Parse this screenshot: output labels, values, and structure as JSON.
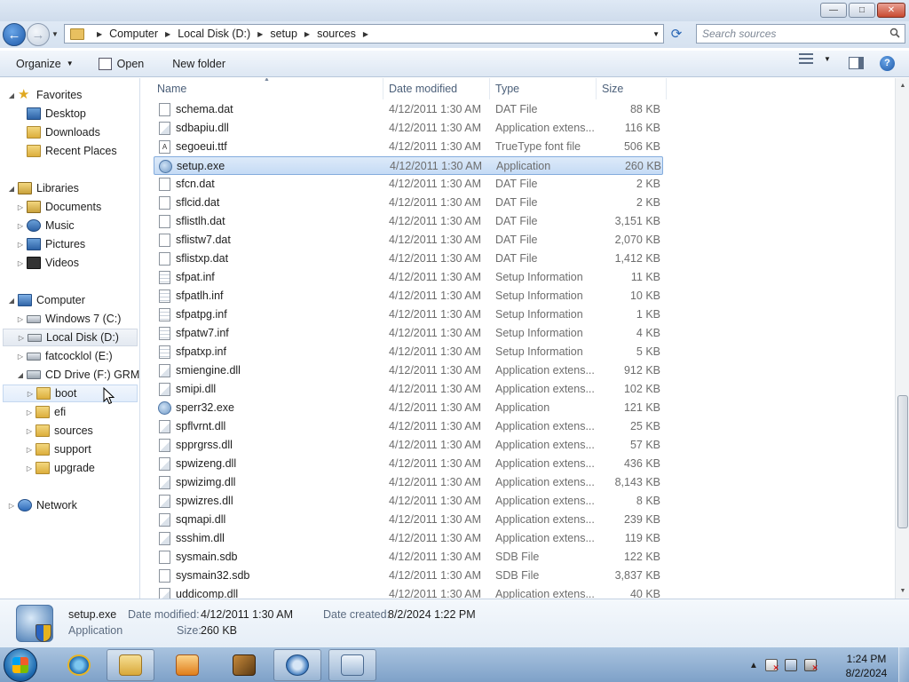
{
  "window": {
    "min": "—",
    "max": "□",
    "close": "✕"
  },
  "address": {
    "crumbs": [
      "Computer",
      "Local Disk (D:)",
      "setup",
      "sources"
    ],
    "search_placeholder": "Search sources"
  },
  "toolbar": {
    "organize": "Organize",
    "open": "Open",
    "new_folder": "New folder"
  },
  "nav": {
    "favorites": "Favorites",
    "desktop": "Desktop",
    "downloads": "Downloads",
    "recent": "Recent Places",
    "libraries": "Libraries",
    "documents": "Documents",
    "music": "Music",
    "pictures": "Pictures",
    "videos": "Videos",
    "computer": "Computer",
    "c_drive": "Windows 7 (C:)",
    "d_drive": "Local Disk (D:)",
    "e_drive": "fatcocklol (E:)",
    "f_drive": "CD Drive (F:) GRMSX",
    "boot": "boot",
    "efi": "efi",
    "sources": "sources",
    "support": "support",
    "upgrade": "upgrade",
    "network": "Network"
  },
  "columns": {
    "name": "Name",
    "date": "Date modified",
    "type": "Type",
    "size": "Size"
  },
  "files": [
    {
      "name": "schema.dat",
      "date": "4/12/2011 1:30 AM",
      "type": "DAT File",
      "size": "88 KB",
      "icon": "dat"
    },
    {
      "name": "sdbapiu.dll",
      "date": "4/12/2011 1:30 AM",
      "type": "Application extens...",
      "size": "116 KB",
      "icon": "dll"
    },
    {
      "name": "segoeui.ttf",
      "date": "4/12/2011 1:30 AM",
      "type": "TrueType font file",
      "size": "506 KB",
      "icon": "ttf"
    },
    {
      "name": "setup.exe",
      "date": "4/12/2011 1:30 AM",
      "type": "Application",
      "size": "260 KB",
      "icon": "exe"
    },
    {
      "name": "sfcn.dat",
      "date": "4/12/2011 1:30 AM",
      "type": "DAT File",
      "size": "2 KB",
      "icon": "dat"
    },
    {
      "name": "sflcid.dat",
      "date": "4/12/2011 1:30 AM",
      "type": "DAT File",
      "size": "2 KB",
      "icon": "dat"
    },
    {
      "name": "sflistlh.dat",
      "date": "4/12/2011 1:30 AM",
      "type": "DAT File",
      "size": "3,151 KB",
      "icon": "dat"
    },
    {
      "name": "sflistw7.dat",
      "date": "4/12/2011 1:30 AM",
      "type": "DAT File",
      "size": "2,070 KB",
      "icon": "dat"
    },
    {
      "name": "sflistxp.dat",
      "date": "4/12/2011 1:30 AM",
      "type": "DAT File",
      "size": "1,412 KB",
      "icon": "dat"
    },
    {
      "name": "sfpat.inf",
      "date": "4/12/2011 1:30 AM",
      "type": "Setup Information",
      "size": "11 KB",
      "icon": "inf"
    },
    {
      "name": "sfpatlh.inf",
      "date": "4/12/2011 1:30 AM",
      "type": "Setup Information",
      "size": "10 KB",
      "icon": "inf"
    },
    {
      "name": "sfpatpg.inf",
      "date": "4/12/2011 1:30 AM",
      "type": "Setup Information",
      "size": "1 KB",
      "icon": "inf"
    },
    {
      "name": "sfpatw7.inf",
      "date": "4/12/2011 1:30 AM",
      "type": "Setup Information",
      "size": "4 KB",
      "icon": "inf"
    },
    {
      "name": "sfpatxp.inf",
      "date": "4/12/2011 1:30 AM",
      "type": "Setup Information",
      "size": "5 KB",
      "icon": "inf"
    },
    {
      "name": "smiengine.dll",
      "date": "4/12/2011 1:30 AM",
      "type": "Application extens...",
      "size": "912 KB",
      "icon": "dll"
    },
    {
      "name": "smipi.dll",
      "date": "4/12/2011 1:30 AM",
      "type": "Application extens...",
      "size": "102 KB",
      "icon": "dll"
    },
    {
      "name": "sperr32.exe",
      "date": "4/12/2011 1:30 AM",
      "type": "Application",
      "size": "121 KB",
      "icon": "exe"
    },
    {
      "name": "spflvrnt.dll",
      "date": "4/12/2011 1:30 AM",
      "type": "Application extens...",
      "size": "25 KB",
      "icon": "dll"
    },
    {
      "name": "spprgrss.dll",
      "date": "4/12/2011 1:30 AM",
      "type": "Application extens...",
      "size": "57 KB",
      "icon": "dll"
    },
    {
      "name": "spwizeng.dll",
      "date": "4/12/2011 1:30 AM",
      "type": "Application extens...",
      "size": "436 KB",
      "icon": "dll"
    },
    {
      "name": "spwizimg.dll",
      "date": "4/12/2011 1:30 AM",
      "type": "Application extens...",
      "size": "8,143 KB",
      "icon": "dll"
    },
    {
      "name": "spwizres.dll",
      "date": "4/12/2011 1:30 AM",
      "type": "Application extens...",
      "size": "8 KB",
      "icon": "dll"
    },
    {
      "name": "sqmapi.dll",
      "date": "4/12/2011 1:30 AM",
      "type": "Application extens...",
      "size": "239 KB",
      "icon": "dll"
    },
    {
      "name": "ssshim.dll",
      "date": "4/12/2011 1:30 AM",
      "type": "Application extens...",
      "size": "119 KB",
      "icon": "dll"
    },
    {
      "name": "sysmain.sdb",
      "date": "4/12/2011 1:30 AM",
      "type": "SDB File",
      "size": "122 KB",
      "icon": "dat"
    },
    {
      "name": "sysmain32.sdb",
      "date": "4/12/2011 1:30 AM",
      "type": "SDB File",
      "size": "3,837 KB",
      "icon": "dat"
    },
    {
      "name": "uddicomp.dll",
      "date": "4/12/2011 1:30 AM",
      "type": "Application extens...",
      "size": "40 KB",
      "icon": "dll"
    }
  ],
  "details": {
    "name": "setup.exe",
    "type": "Application",
    "modified_label": "Date modified:",
    "modified": "4/12/2011 1:30 AM",
    "created_label": "Date created:",
    "created": "8/2/2024 1:22 PM",
    "size_label": "Size:",
    "size": "260 KB"
  },
  "clock": {
    "time": "1:24 PM",
    "date": "8/2/2024"
  }
}
